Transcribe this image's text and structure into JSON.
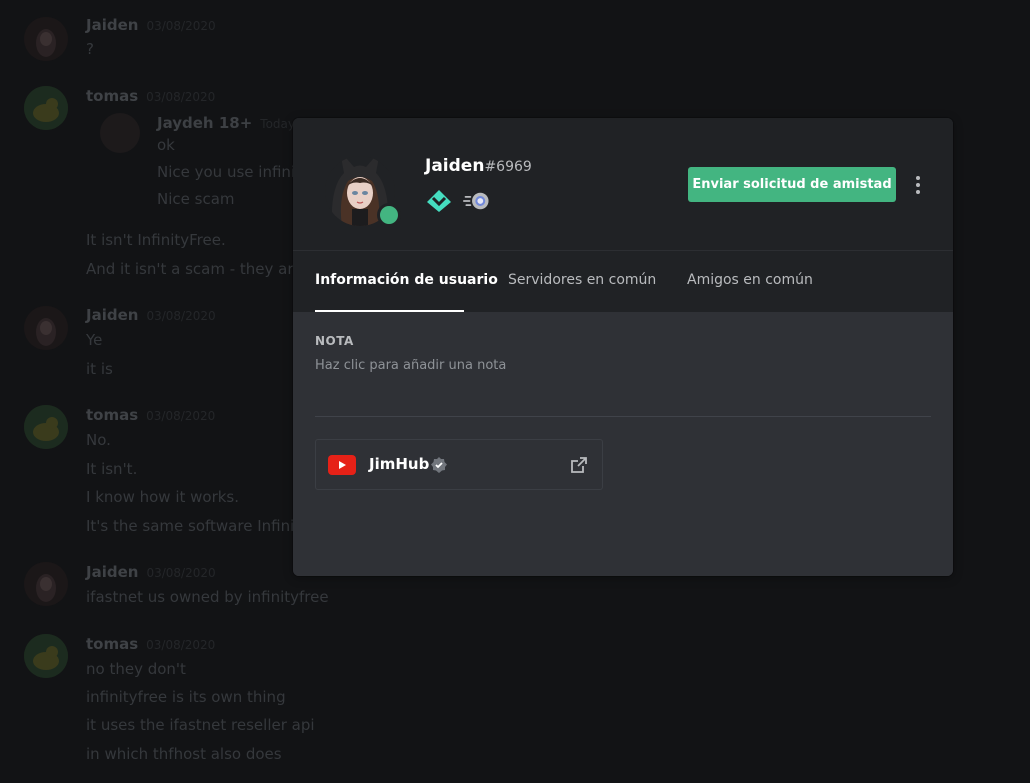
{
  "chat": {
    "messages": [
      {
        "author": "Jaiden",
        "time": "03/08/2020",
        "lines": [
          "?"
        ]
      },
      {
        "author": "tomas",
        "time": "03/08/2020",
        "reply": {
          "author": "Jaydeh 18+",
          "time": "Today at",
          "lines": [
            "ok",
            "Nice you use infinity",
            "Nice scam"
          ]
        },
        "lines": [
          "It isn't InfinityFree.",
          "And it isn't a scam - they are"
        ]
      },
      {
        "author": "Jaiden",
        "time": "03/08/2020",
        "lines": [
          "Ye",
          "it is"
        ]
      },
      {
        "author": "tomas",
        "time": "03/08/2020",
        "lines": [
          "No.",
          "It isn't.",
          "I know how it works.",
          "It's the same software Infinit"
        ]
      },
      {
        "author": "Jaiden",
        "time": "03/08/2020",
        "lines": [
          "ifastnet us owned by infinityfree"
        ]
      },
      {
        "author": "tomas",
        "time": "03/08/2020",
        "lines": [
          "no they don't",
          "infinityfree is its own thing",
          "it uses the ifastnet reseller api",
          "in which thfhost also does"
        ]
      }
    ]
  },
  "profile": {
    "username": "Jaiden",
    "discriminator": "#6969",
    "status": "online",
    "badges": [
      "hypesquad-balance-icon",
      "nitro-icon"
    ],
    "friend_request_label": "Enviar solicitud de amistad"
  },
  "tabs": {
    "user_info": "Información de usuario",
    "mutual_servers": "Servidores en común",
    "mutual_friends": "Amigos en común",
    "active": "user_info"
  },
  "note": {
    "title": "NOTA",
    "placeholder": "Haz clic para añadir una nota"
  },
  "connections": [
    {
      "platform": "youtube",
      "name": "JimHub",
      "verified": true
    }
  ],
  "colors": {
    "accent_green": "#43b581",
    "youtube_red": "#e62117"
  }
}
